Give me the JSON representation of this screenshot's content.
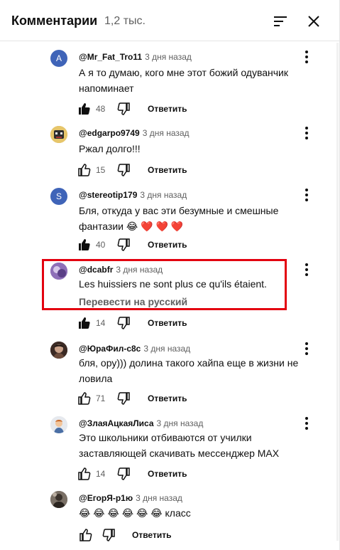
{
  "header": {
    "title": "Комментарии",
    "count": "1,2 тыс."
  },
  "reply_label": "Ответить",
  "comments": [
    {
      "author": "@Mr_Fat_Tro11",
      "time": "3 дня назад",
      "avatar_letter": "A",
      "avatar_color": "#3f64b8",
      "text": "А я то думаю, кого мне этот божий одуванчик напоминает",
      "likes": "48",
      "liked": true
    },
    {
      "author": "@edgarpo9749",
      "time": "3 дня назад",
      "avatar_color": "#c8a14b",
      "text": "Ржал долго!!!",
      "likes": "15",
      "liked": false
    },
    {
      "author": "@stereotip179",
      "time": "3 дня назад",
      "avatar_letter": "S",
      "avatar_color": "#3f64b8",
      "text": "Бля, откуда у вас эти безумные и смешные фантазии 😂 ❤️ ❤️ ❤️",
      "likes": "40",
      "liked": true
    },
    {
      "author": "@dcabfr",
      "time": "3 дня назад",
      "avatar_color": "#7b5aa8",
      "text": "Les huissiers ne sont plus ce qu'ils étaient.",
      "translate": "Перевести на русский",
      "likes": "14",
      "liked": true
    },
    {
      "author": "@ЮраФил-с8с",
      "time": "3 дня назад",
      "avatar_color": "#5a3a2e",
      "text": "бля, ору))) долина такого хайпа еще в жизни не ловила",
      "likes": "71",
      "liked": false
    },
    {
      "author": "@ЗлаяАцкаяЛиса",
      "time": "3 дня назад",
      "avatar_color": "#d9dde3",
      "text": "Это школьники отбиваются от училки заставляющей скачивать мессенджер MAX",
      "likes": "14",
      "liked": false
    },
    {
      "author": "@ЕгорЯ-р1ю",
      "time": "3 дня назад",
      "avatar_color": "#6b6258",
      "text": "😂 😂 😂 😂 😂 😂 класс",
      "likes": "",
      "liked": false
    }
  ]
}
